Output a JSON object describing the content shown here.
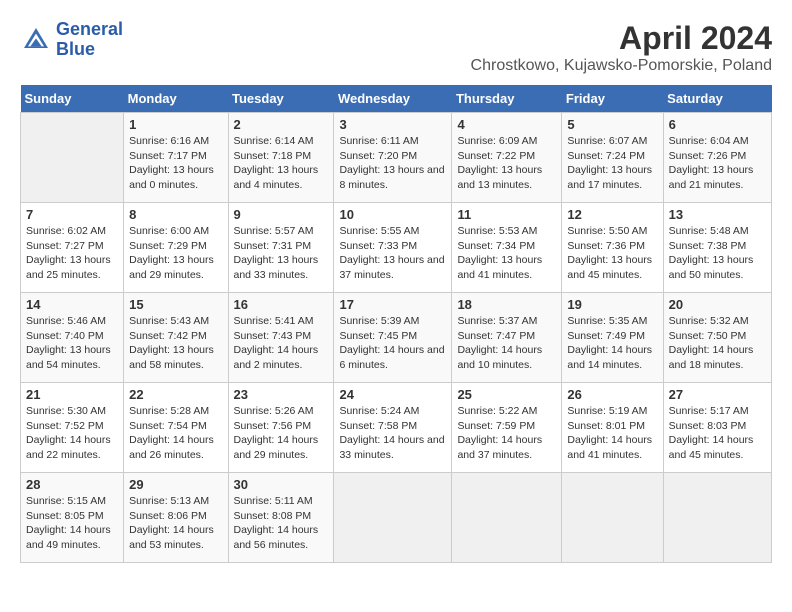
{
  "header": {
    "logo_line1": "General",
    "logo_line2": "Blue",
    "title": "April 2024",
    "subtitle": "Chrostkowo, Kujawsko-Pomorskie, Poland"
  },
  "days_of_week": [
    "Sunday",
    "Monday",
    "Tuesday",
    "Wednesday",
    "Thursday",
    "Friday",
    "Saturday"
  ],
  "weeks": [
    {
      "cells": [
        {
          "day": null
        },
        {
          "day": "1",
          "sunrise": "Sunrise: 6:16 AM",
          "sunset": "Sunset: 7:17 PM",
          "daylight": "Daylight: 13 hours and 0 minutes."
        },
        {
          "day": "2",
          "sunrise": "Sunrise: 6:14 AM",
          "sunset": "Sunset: 7:18 PM",
          "daylight": "Daylight: 13 hours and 4 minutes."
        },
        {
          "day": "3",
          "sunrise": "Sunrise: 6:11 AM",
          "sunset": "Sunset: 7:20 PM",
          "daylight": "Daylight: 13 hours and 8 minutes."
        },
        {
          "day": "4",
          "sunrise": "Sunrise: 6:09 AM",
          "sunset": "Sunset: 7:22 PM",
          "daylight": "Daylight: 13 hours and 13 minutes."
        },
        {
          "day": "5",
          "sunrise": "Sunrise: 6:07 AM",
          "sunset": "Sunset: 7:24 PM",
          "daylight": "Daylight: 13 hours and 17 minutes."
        },
        {
          "day": "6",
          "sunrise": "Sunrise: 6:04 AM",
          "sunset": "Sunset: 7:26 PM",
          "daylight": "Daylight: 13 hours and 21 minutes."
        }
      ]
    },
    {
      "cells": [
        {
          "day": "7",
          "sunrise": "Sunrise: 6:02 AM",
          "sunset": "Sunset: 7:27 PM",
          "daylight": "Daylight: 13 hours and 25 minutes."
        },
        {
          "day": "8",
          "sunrise": "Sunrise: 6:00 AM",
          "sunset": "Sunset: 7:29 PM",
          "daylight": "Daylight: 13 hours and 29 minutes."
        },
        {
          "day": "9",
          "sunrise": "Sunrise: 5:57 AM",
          "sunset": "Sunset: 7:31 PM",
          "daylight": "Daylight: 13 hours and 33 minutes."
        },
        {
          "day": "10",
          "sunrise": "Sunrise: 5:55 AM",
          "sunset": "Sunset: 7:33 PM",
          "daylight": "Daylight: 13 hours and 37 minutes."
        },
        {
          "day": "11",
          "sunrise": "Sunrise: 5:53 AM",
          "sunset": "Sunset: 7:34 PM",
          "daylight": "Daylight: 13 hours and 41 minutes."
        },
        {
          "day": "12",
          "sunrise": "Sunrise: 5:50 AM",
          "sunset": "Sunset: 7:36 PM",
          "daylight": "Daylight: 13 hours and 45 minutes."
        },
        {
          "day": "13",
          "sunrise": "Sunrise: 5:48 AM",
          "sunset": "Sunset: 7:38 PM",
          "daylight": "Daylight: 13 hours and 50 minutes."
        }
      ]
    },
    {
      "cells": [
        {
          "day": "14",
          "sunrise": "Sunrise: 5:46 AM",
          "sunset": "Sunset: 7:40 PM",
          "daylight": "Daylight: 13 hours and 54 minutes."
        },
        {
          "day": "15",
          "sunrise": "Sunrise: 5:43 AM",
          "sunset": "Sunset: 7:42 PM",
          "daylight": "Daylight: 13 hours and 58 minutes."
        },
        {
          "day": "16",
          "sunrise": "Sunrise: 5:41 AM",
          "sunset": "Sunset: 7:43 PM",
          "daylight": "Daylight: 14 hours and 2 minutes."
        },
        {
          "day": "17",
          "sunrise": "Sunrise: 5:39 AM",
          "sunset": "Sunset: 7:45 PM",
          "daylight": "Daylight: 14 hours and 6 minutes."
        },
        {
          "day": "18",
          "sunrise": "Sunrise: 5:37 AM",
          "sunset": "Sunset: 7:47 PM",
          "daylight": "Daylight: 14 hours and 10 minutes."
        },
        {
          "day": "19",
          "sunrise": "Sunrise: 5:35 AM",
          "sunset": "Sunset: 7:49 PM",
          "daylight": "Daylight: 14 hours and 14 minutes."
        },
        {
          "day": "20",
          "sunrise": "Sunrise: 5:32 AM",
          "sunset": "Sunset: 7:50 PM",
          "daylight": "Daylight: 14 hours and 18 minutes."
        }
      ]
    },
    {
      "cells": [
        {
          "day": "21",
          "sunrise": "Sunrise: 5:30 AM",
          "sunset": "Sunset: 7:52 PM",
          "daylight": "Daylight: 14 hours and 22 minutes."
        },
        {
          "day": "22",
          "sunrise": "Sunrise: 5:28 AM",
          "sunset": "Sunset: 7:54 PM",
          "daylight": "Daylight: 14 hours and 26 minutes."
        },
        {
          "day": "23",
          "sunrise": "Sunrise: 5:26 AM",
          "sunset": "Sunset: 7:56 PM",
          "daylight": "Daylight: 14 hours and 29 minutes."
        },
        {
          "day": "24",
          "sunrise": "Sunrise: 5:24 AM",
          "sunset": "Sunset: 7:58 PM",
          "daylight": "Daylight: 14 hours and 33 minutes."
        },
        {
          "day": "25",
          "sunrise": "Sunrise: 5:22 AM",
          "sunset": "Sunset: 7:59 PM",
          "daylight": "Daylight: 14 hours and 37 minutes."
        },
        {
          "day": "26",
          "sunrise": "Sunrise: 5:19 AM",
          "sunset": "Sunset: 8:01 PM",
          "daylight": "Daylight: 14 hours and 41 minutes."
        },
        {
          "day": "27",
          "sunrise": "Sunrise: 5:17 AM",
          "sunset": "Sunset: 8:03 PM",
          "daylight": "Daylight: 14 hours and 45 minutes."
        }
      ]
    },
    {
      "cells": [
        {
          "day": "28",
          "sunrise": "Sunrise: 5:15 AM",
          "sunset": "Sunset: 8:05 PM",
          "daylight": "Daylight: 14 hours and 49 minutes."
        },
        {
          "day": "29",
          "sunrise": "Sunrise: 5:13 AM",
          "sunset": "Sunset: 8:06 PM",
          "daylight": "Daylight: 14 hours and 53 minutes."
        },
        {
          "day": "30",
          "sunrise": "Sunrise: 5:11 AM",
          "sunset": "Sunset: 8:08 PM",
          "daylight": "Daylight: 14 hours and 56 minutes."
        },
        {
          "day": null
        },
        {
          "day": null
        },
        {
          "day": null
        },
        {
          "day": null
        }
      ]
    }
  ]
}
